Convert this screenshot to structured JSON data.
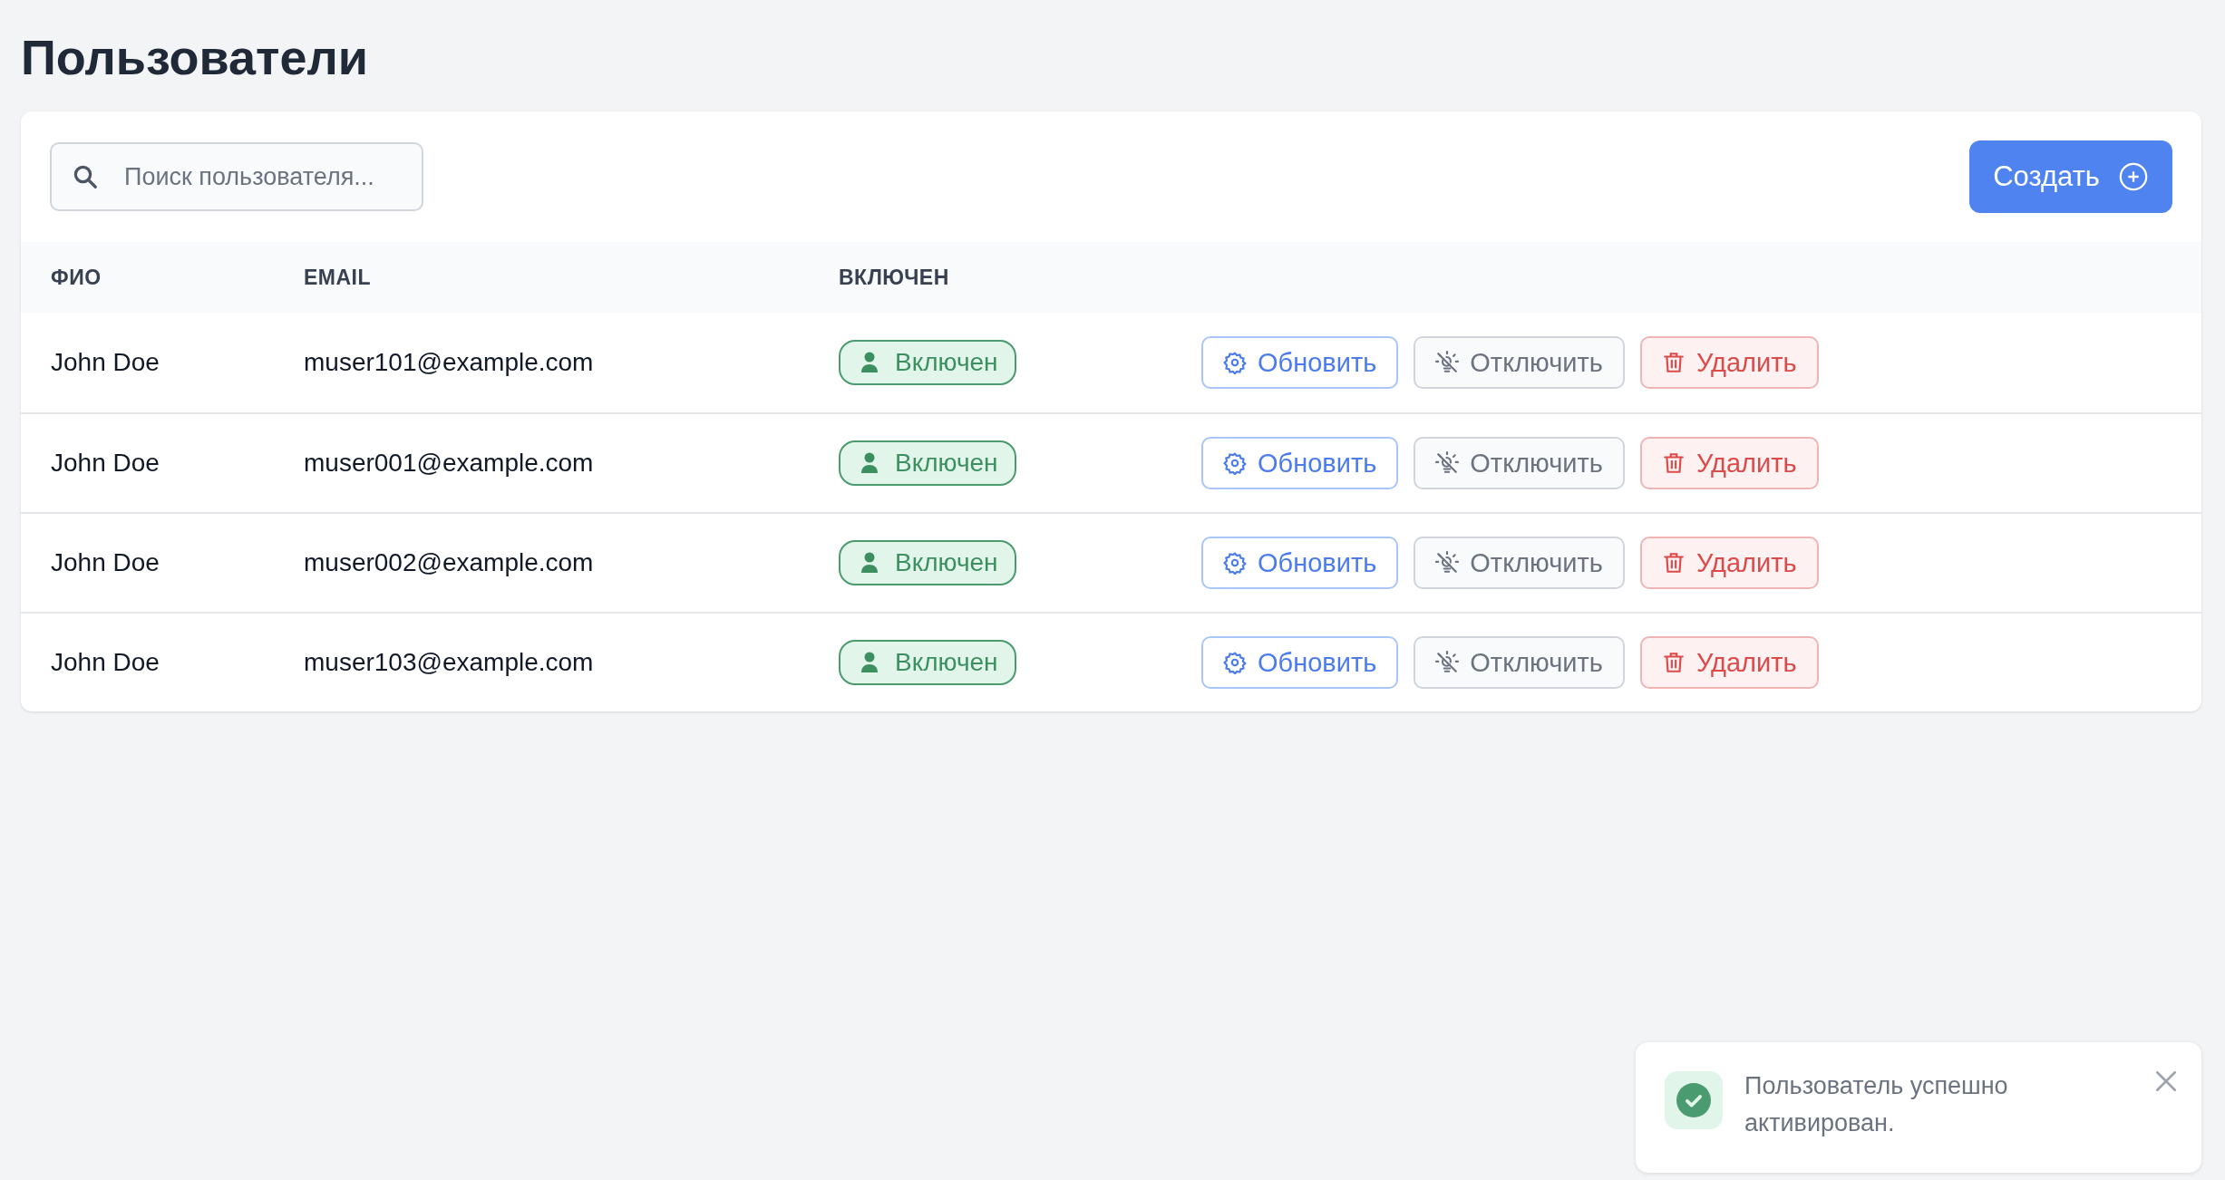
{
  "page": {
    "title": "Пользователи"
  },
  "search": {
    "placeholder": "Поиск пользователя..."
  },
  "create_button": {
    "label": "Создать"
  },
  "table": {
    "columns": [
      "ФИО",
      "EMAIL",
      "ВКЛЮЧЕН"
    ],
    "rows": [
      {
        "name": "John Doe",
        "email": "muser101@example.com",
        "enabled": true,
        "status": "Включен",
        "actions": [
          "Обновить",
          "Отключить",
          "Удалить"
        ]
      },
      {
        "name": "John Doe",
        "email": "muser001@example.com",
        "enabled": true,
        "status": "Включен",
        "actions": [
          "Обновить",
          "Отключить",
          "Удалить"
        ]
      },
      {
        "name": "John Doe",
        "email": "muser002@example.com",
        "enabled": true,
        "status": "Включен",
        "actions": [
          "Обновить",
          "Отключить",
          "Удалить"
        ]
      },
      {
        "name": "John Doe",
        "email": "muser103@example.com",
        "enabled": true,
        "status": "Включен",
        "actions": [
          "Обновить",
          "Отключить",
          "Удалить"
        ]
      }
    ]
  },
  "toast": {
    "kind": "success",
    "message": "Пользователь успешно активирован."
  }
}
